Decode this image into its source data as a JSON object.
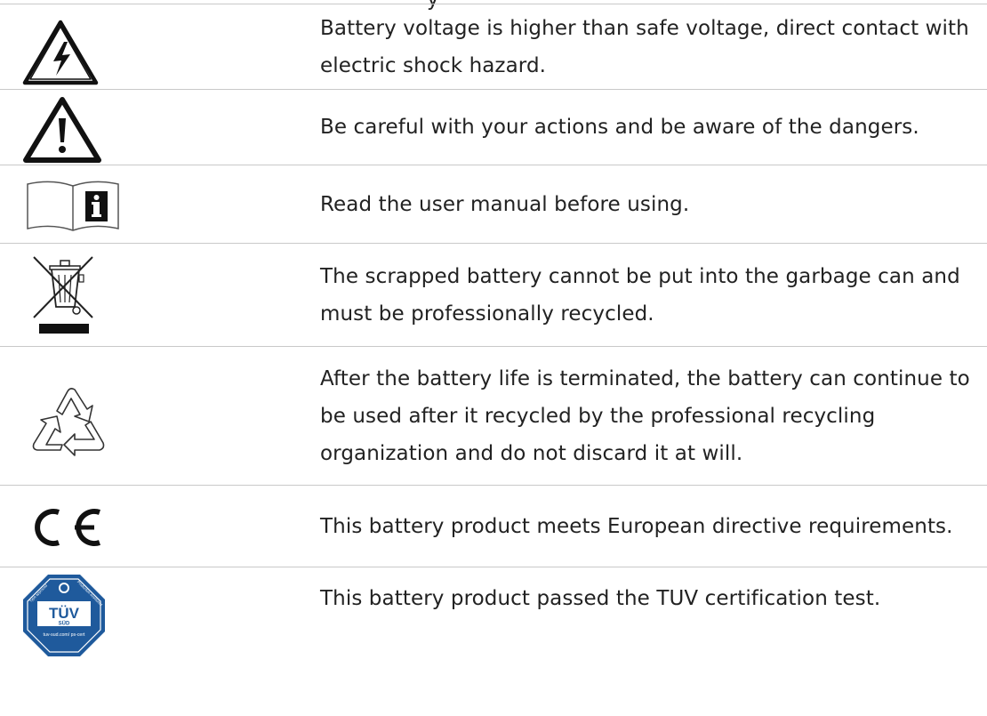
{
  "top_cut_text": "y",
  "rows": [
    {
      "icon": "high-voltage-warning-icon",
      "text": "Battery voltage is higher than safe voltage, direct contact with electric shock hazard."
    },
    {
      "icon": "caution-warning-icon",
      "text": "Be careful with your actions and be aware of the dangers."
    },
    {
      "icon": "read-manual-icon",
      "text": "Read the user manual before using."
    },
    {
      "icon": "crossed-out-bin-icon",
      "text": "The scrapped battery cannot be put into the garbage can and must be professionally recycled."
    },
    {
      "icon": "recycling-icon",
      "text": "After the battery life is terminated, the battery can continue to be used after it recycled by the professional recycling organization and do not discard it at will."
    },
    {
      "icon": "ce-mark-icon",
      "text": "This battery product meets European directive requirements."
    },
    {
      "icon": "tuv-sud-certification-icon",
      "text": "This battery product passed the TUV certification test."
    }
  ],
  "tuv_logo": {
    "main": "TÜV",
    "sub": "SÜD",
    "url": "tuv-sud.com/ ps-cert",
    "arc_left": "Type approved",
    "arc_right": "Production monitored"
  },
  "colors": {
    "text": "#222222",
    "rule": "#c9c9c9",
    "tuv_blue": "#1f5a9c"
  }
}
